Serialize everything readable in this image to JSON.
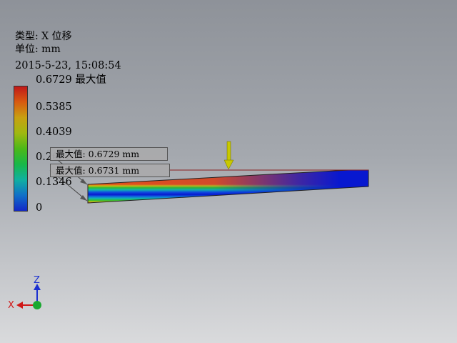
{
  "header": {
    "type_text": "类型: X 位移",
    "unit_text": "单位: mm",
    "date_text": "2015-5-23, 15:08:54"
  },
  "legend": {
    "labels": [
      "0.6729 最大值",
      "0.5385",
      "0.4039",
      "0.2692",
      "0.1346",
      "0"
    ],
    "colors_top_to_bottom": [
      "#c01818",
      "#d85a10",
      "#c8a010",
      "#a0b810",
      "#4cb818",
      "#18b848",
      "#10b0a0",
      "#1070c8",
      "#1428c8"
    ]
  },
  "callouts": [
    {
      "text": "最大值: 0.6729 mm"
    },
    {
      "text": "最大值: 0.6731 mm"
    }
  ],
  "load_arrow": {
    "color": "#c8c800",
    "icon": "down-arrow-icon"
  },
  "axes": {
    "z_label": "Z",
    "x_label": "X",
    "z_color": "#1a2fd0",
    "x_color": "#d01818",
    "origin_color": "#1aa830"
  }
}
